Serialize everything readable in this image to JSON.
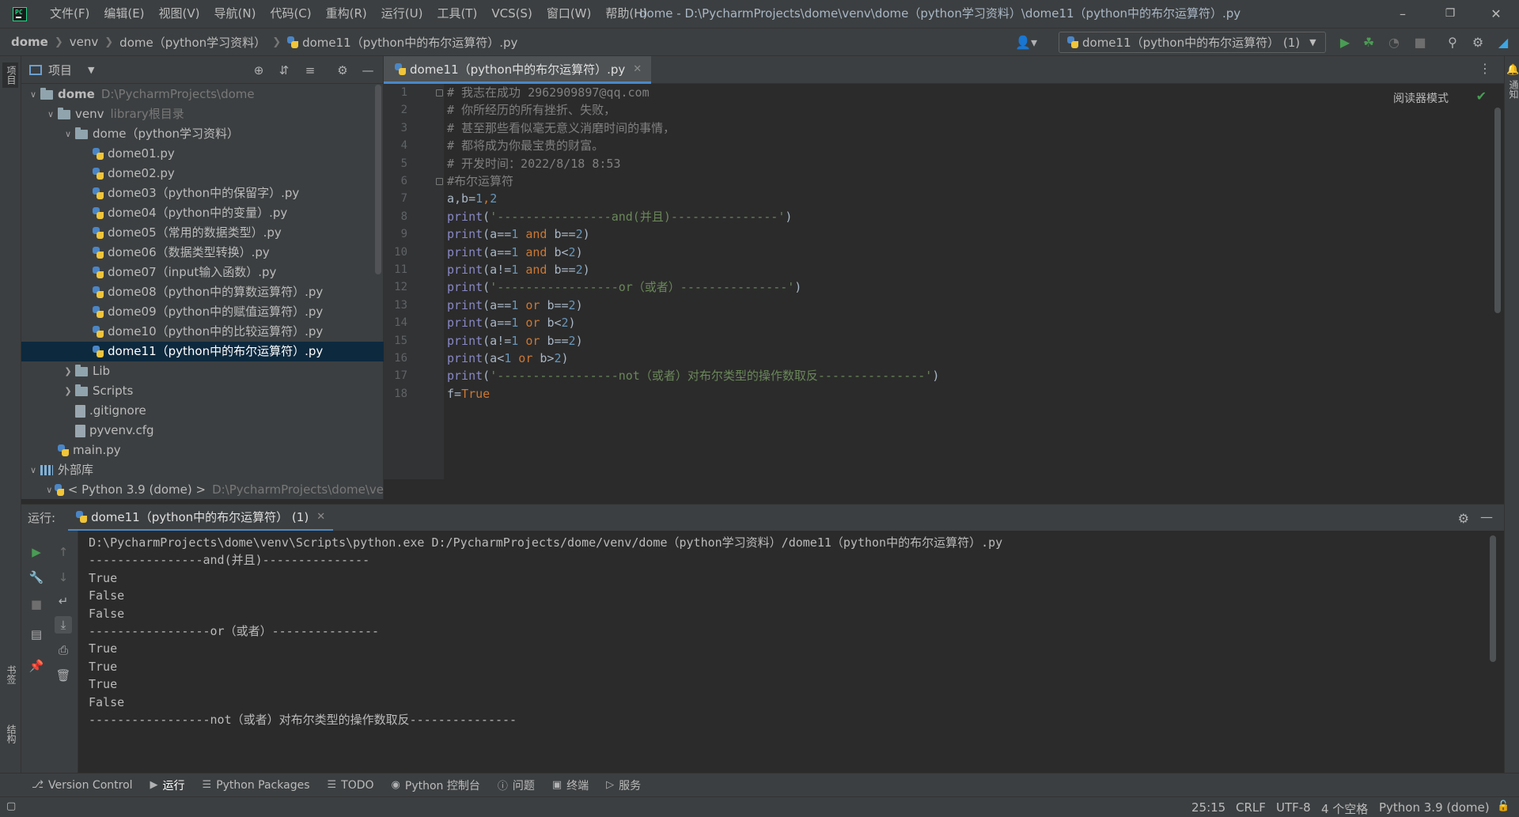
{
  "menu": {
    "items": [
      "文件(F)",
      "编辑(E)",
      "视图(V)",
      "导航(N)",
      "代码(C)",
      "重构(R)",
      "运行(U)",
      "工具(T)",
      "VCS(S)",
      "窗口(W)",
      "帮助(H)"
    ]
  },
  "window": {
    "title": "dome - D:\\PycharmProjects\\dome\\venv\\dome（python学习资料）\\dome11（python中的布尔运算符）.py"
  },
  "breadcrumbs": [
    "dome",
    "venv",
    "dome（python学习资料）",
    "dome11（python中的布尔运算符）.py"
  ],
  "run_config": {
    "label": "dome11（python中的布尔运算符） (1)"
  },
  "left_strip": {
    "project_tab": "项目",
    "bookmarks_tab": "书签",
    "structure_tab": "结构"
  },
  "right_strip": {
    "notifications_tab": "通知"
  },
  "project_panel": {
    "title": "项目",
    "tree": [
      {
        "label": "dome",
        "hint": "D:\\PycharmProjects\\dome",
        "kind": "folder",
        "depth": 0,
        "arrow": "expanded",
        "bold": true
      },
      {
        "label": "venv",
        "hint": "library根目录",
        "kind": "folder",
        "depth": 1,
        "arrow": "expanded"
      },
      {
        "label": "dome（python学习资料）",
        "hint": "",
        "kind": "folder",
        "depth": 2,
        "arrow": "expanded"
      },
      {
        "label": "dome01.py",
        "hint": "",
        "kind": "py",
        "depth": 3,
        "arrow": "none"
      },
      {
        "label": "dome02.py",
        "hint": "",
        "kind": "py",
        "depth": 3,
        "arrow": "none"
      },
      {
        "label": "dome03（python中的保留字）.py",
        "hint": "",
        "kind": "py",
        "depth": 3,
        "arrow": "none"
      },
      {
        "label": "dome04（python中的变量）.py",
        "hint": "",
        "kind": "py",
        "depth": 3,
        "arrow": "none"
      },
      {
        "label": "dome05（常用的数据类型）.py",
        "hint": "",
        "kind": "py",
        "depth": 3,
        "arrow": "none"
      },
      {
        "label": "dome06（数据类型转换）.py",
        "hint": "",
        "kind": "py",
        "depth": 3,
        "arrow": "none"
      },
      {
        "label": "dome07（input输入函数）.py",
        "hint": "",
        "kind": "py",
        "depth": 3,
        "arrow": "none"
      },
      {
        "label": "dome08（python中的算数运算符）.py",
        "hint": "",
        "kind": "py",
        "depth": 3,
        "arrow": "none"
      },
      {
        "label": "dome09（python中的赋值运算符）.py",
        "hint": "",
        "kind": "py",
        "depth": 3,
        "arrow": "none"
      },
      {
        "label": "dome10（python中的比较运算符）.py",
        "hint": "",
        "kind": "py",
        "depth": 3,
        "arrow": "none"
      },
      {
        "label": "dome11（python中的布尔运算符）.py",
        "hint": "",
        "kind": "py",
        "depth": 3,
        "arrow": "none",
        "selected": true
      },
      {
        "label": "Lib",
        "hint": "",
        "kind": "folder",
        "depth": 2,
        "arrow": "collapsed"
      },
      {
        "label": "Scripts",
        "hint": "",
        "kind": "folder",
        "depth": 2,
        "arrow": "collapsed"
      },
      {
        "label": ".gitignore",
        "hint": "",
        "kind": "file",
        "depth": 2,
        "arrow": "none"
      },
      {
        "label": "pyvenv.cfg",
        "hint": "",
        "kind": "file",
        "depth": 2,
        "arrow": "none"
      },
      {
        "label": "main.py",
        "hint": "",
        "kind": "py",
        "depth": 1,
        "arrow": "none"
      },
      {
        "label": "外部库",
        "hint": "",
        "kind": "lib",
        "depth": 0,
        "arrow": "expanded"
      },
      {
        "label": "< Python 3.9 (dome) >",
        "hint": "D:\\PycharmProjects\\dome\\ve",
        "kind": "py",
        "depth": 1,
        "arrow": "expanded"
      }
    ]
  },
  "editor": {
    "tab_label": "dome11（python中的布尔运算符）.py",
    "reader_mode": "阅读器模式",
    "lines": [
      [
        [
          "# 我志在成功 2962909897@qq.com",
          "comment"
        ]
      ],
      [
        [
          "# 你所经历的所有挫折、失败，",
          "comment"
        ]
      ],
      [
        [
          "# 甚至那些看似毫无意义消磨时间的事情，",
          "comment"
        ]
      ],
      [
        [
          "# 都将成为你最宝贵的财富。",
          "comment"
        ]
      ],
      [
        [
          "# 开发时间：2022/8/18 8:53",
          "comment"
        ]
      ],
      [
        [
          "#布尔运算符",
          "comment"
        ]
      ],
      [
        [
          "a,b=",
          "plain"
        ],
        [
          "1",
          "num"
        ],
        [
          ",",
          "kw"
        ],
        [
          "2",
          "num"
        ]
      ],
      [
        [
          "print",
          "builtin"
        ],
        [
          "(",
          "plain"
        ],
        [
          "'----------------and(并且)---------------'",
          "str"
        ],
        [
          ")",
          "plain"
        ]
      ],
      [
        [
          "print",
          "builtin"
        ],
        [
          "(a==",
          "plain"
        ],
        [
          "1",
          "num"
        ],
        [
          " and ",
          "kw"
        ],
        [
          "b==",
          "plain"
        ],
        [
          "2",
          "num"
        ],
        [
          ")",
          "plain"
        ]
      ],
      [
        [
          "print",
          "builtin"
        ],
        [
          "(a==",
          "plain"
        ],
        [
          "1",
          "num"
        ],
        [
          " and ",
          "kw"
        ],
        [
          "b<",
          "plain"
        ],
        [
          "2",
          "num"
        ],
        [
          ")",
          "plain"
        ]
      ],
      [
        [
          "print",
          "builtin"
        ],
        [
          "(a!=",
          "plain"
        ],
        [
          "1",
          "num"
        ],
        [
          " and ",
          "kw"
        ],
        [
          "b==",
          "plain"
        ],
        [
          "2",
          "num"
        ],
        [
          ")",
          "plain"
        ]
      ],
      [
        [
          "print",
          "builtin"
        ],
        [
          "(",
          "plain"
        ],
        [
          "'-----------------or（或者）---------------'",
          "str"
        ],
        [
          ")",
          "plain"
        ]
      ],
      [
        [
          "print",
          "builtin"
        ],
        [
          "(a==",
          "plain"
        ],
        [
          "1",
          "num"
        ],
        [
          " or ",
          "kw"
        ],
        [
          "b==",
          "plain"
        ],
        [
          "2",
          "num"
        ],
        [
          ")",
          "plain"
        ]
      ],
      [
        [
          "print",
          "builtin"
        ],
        [
          "(a==",
          "plain"
        ],
        [
          "1",
          "num"
        ],
        [
          " or ",
          "kw"
        ],
        [
          "b<",
          "plain"
        ],
        [
          "2",
          "num"
        ],
        [
          ")",
          "plain"
        ]
      ],
      [
        [
          "print",
          "builtin"
        ],
        [
          "(a!=",
          "plain"
        ],
        [
          "1",
          "num"
        ],
        [
          " or ",
          "kw"
        ],
        [
          "b==",
          "plain"
        ],
        [
          "2",
          "num"
        ],
        [
          ")",
          "plain"
        ]
      ],
      [
        [
          "print",
          "builtin"
        ],
        [
          "(a<",
          "plain"
        ],
        [
          "1",
          "num"
        ],
        [
          " or ",
          "kw"
        ],
        [
          "b>",
          "plain"
        ],
        [
          "2",
          "num"
        ],
        [
          ")",
          "plain"
        ]
      ],
      [
        [
          "print",
          "builtin"
        ],
        [
          "(",
          "plain"
        ],
        [
          "'-----------------not（或者）对布尔类型的操作数取反---------------'",
          "str"
        ],
        [
          ")",
          "plain"
        ]
      ],
      [
        [
          "f=",
          "plain"
        ],
        [
          "True",
          "kw"
        ]
      ]
    ]
  },
  "run_panel": {
    "label": "运行:",
    "tab_label": "dome11（python中的布尔运算符） (1)",
    "output": [
      "D:\\PycharmProjects\\dome\\venv\\Scripts\\python.exe D:/PycharmProjects/dome/venv/dome（python学习资料）/dome11（python中的布尔运算符）.py",
      "----------------and(并且)---------------",
      "True",
      "False",
      "False",
      "-----------------or（或者）---------------",
      "True",
      "True",
      "True",
      "False",
      "-----------------not（或者）对布尔类型的操作数取反---------------"
    ]
  },
  "bottom_tabs": [
    {
      "label": "Version Control",
      "icon": "branch-icon"
    },
    {
      "label": "运行",
      "icon": "play-icon",
      "active": true
    },
    {
      "label": "Python Packages",
      "icon": "layers-icon"
    },
    {
      "label": "TODO",
      "icon": "list-icon"
    },
    {
      "label": "Python 控制台",
      "icon": "console-icon"
    },
    {
      "label": "问题",
      "icon": "problems-icon"
    },
    {
      "label": "终端",
      "icon": "terminal-icon"
    },
    {
      "label": "服务",
      "icon": "services-icon"
    }
  ],
  "statusbar": {
    "position": "25:15",
    "line_sep": "CRLF",
    "encoding": "UTF-8",
    "indent": "4 个空格",
    "interpreter": "Python 3.9 (dome)"
  },
  "colors": {
    "accent": "#4a88c7",
    "selection": "#0d293e",
    "run_green": "#499c54"
  }
}
